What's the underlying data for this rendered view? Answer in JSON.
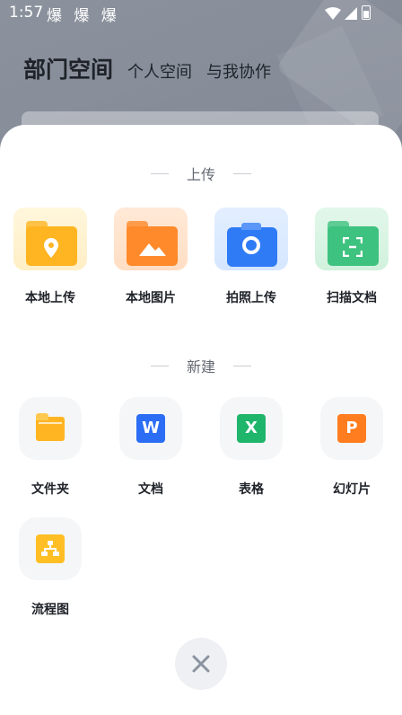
{
  "status": {
    "time": "1:57",
    "notifications": "爆 爆 爆"
  },
  "header": {
    "title": "部门空间",
    "tabs": [
      "个人空间",
      "与我协作"
    ]
  },
  "sheet": {
    "upload_title": "上传",
    "upload_items": [
      {
        "label": "本地上传",
        "icon": "location-folder-icon"
      },
      {
        "label": "本地图片",
        "icon": "image-folder-icon"
      },
      {
        "label": "拍照上传",
        "icon": "camera-icon"
      },
      {
        "label": "扫描文档",
        "icon": "scan-icon"
      }
    ],
    "new_title": "新建",
    "new_items": [
      {
        "label": "文件夹",
        "icon": "folder-icon"
      },
      {
        "label": "文档",
        "icon": "word-doc-icon",
        "glyph": "W"
      },
      {
        "label": "表格",
        "icon": "spreadsheet-icon",
        "glyph": "X"
      },
      {
        "label": "幻灯片",
        "icon": "slides-icon",
        "glyph": "P"
      },
      {
        "label": "流程图",
        "icon": "flowchart-icon"
      }
    ]
  },
  "colors": {
    "accent_yellow": "#ffb522",
    "accent_orange": "#ff8a2b",
    "accent_blue": "#2f7bf6",
    "accent_green": "#3ec27f",
    "word_blue": "#2b6ef5",
    "excel_green": "#1fb56b",
    "ppt_orange": "#ff7d1e"
  }
}
